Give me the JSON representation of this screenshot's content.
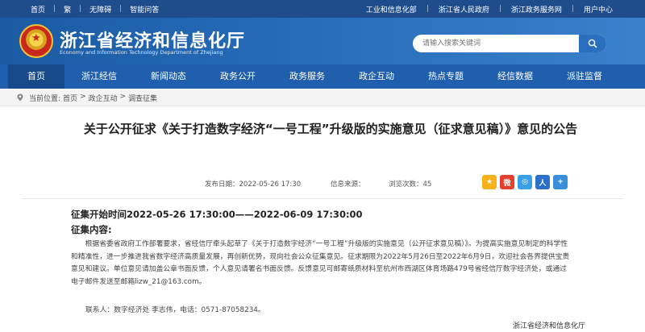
{
  "topbar": {
    "left": [
      "首页",
      "繁",
      "无障碍",
      "智能问答"
    ],
    "right": [
      "工业和信息化部",
      "浙江省人民政府",
      "浙江政务服务网",
      "用户中心"
    ]
  },
  "header": {
    "title": "浙江省经济和信息化厅",
    "subtitle": "Economy and Information Technology Department of Zhejiang",
    "search_placeholder": "请输入搜索关键词"
  },
  "nav": [
    "首页",
    "浙江经信",
    "新闻动态",
    "政务公开",
    "政务服务",
    "政企互动",
    "热点专题",
    "经信数据",
    "派驻监督"
  ],
  "breadcrumb": {
    "prefix": "当前位置:",
    "items": [
      "首页",
      "政企互动",
      "调查征集"
    ],
    "separator": ">"
  },
  "article": {
    "title": "关于公开征求《关于打造数字经济“一号工程”升级版的实施意见（征求意见稿）》意见的公告",
    "published_label": "发布日期：2022-05-26 17:30",
    "source_label": "信息来源：",
    "views_label": "浏览次数：45",
    "period": "征集开始时间2022-05-26 17:30:00——2022-06-09 17:30:00",
    "content_heading": "征集内容:",
    "paragraph": "根据省委省政府工作部署要求，省经信厅牵头起草了《关于打造数字经济“一号工程”升级版的实施意见（公开征求意见稿）》。为提高实施意见制定的科学性和精准性，进一步推进我省数字经济高质量发展，再创新优势，现向社会公众征集意见。征求期限为2022年5月26日至2022年6月9日，欢迎社会各界提供宝贵意见和建议。单位意见请加盖公章书面反馈，个人意见请署名书面反馈。反馈意见可邮寄纸质材料至杭州市西湖区体育场路479号省经信厅数字经济处，或通过电子邮件发送至邮箱lizw_21@163.com。",
    "contact": "联系人：数字经济处 李志伟，电话：0571-87058234。",
    "org": "浙江省经济和信息化厅"
  },
  "colors": {
    "topbar": "#1f4d8c",
    "nav": "#1f5fae",
    "nav_active": "#174a8a"
  }
}
